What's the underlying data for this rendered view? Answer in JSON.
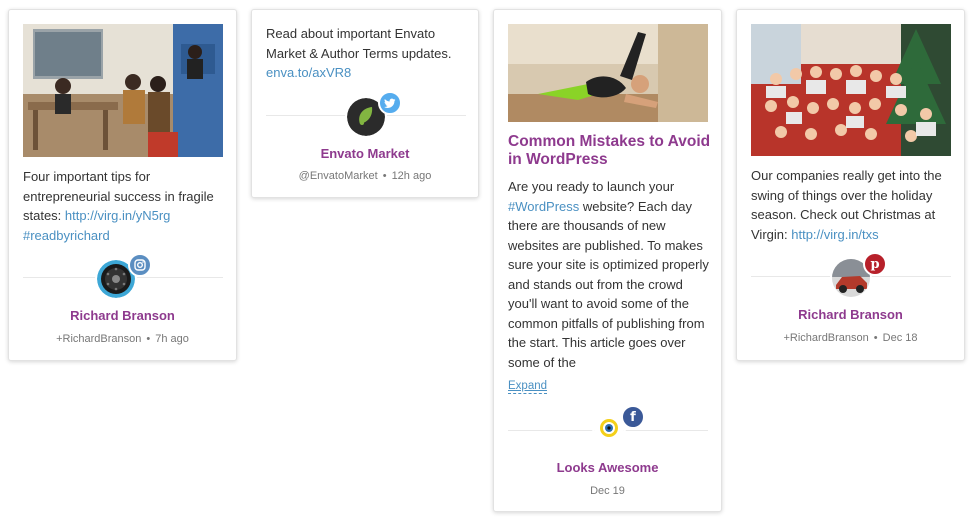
{
  "cards": [
    {
      "text_before_link": "Four important tips for entrepreneurial success in fragile states: ",
      "link": "http://virg.in/yN5rg",
      "hashtag": "#readbyrichard",
      "source_icon": "instagram-icon",
      "author": "Richard Branson",
      "handle": "+RichardBranson",
      "time": "7h ago"
    },
    {
      "text_before_link": "Read about important Envato Market & Author Terms updates.",
      "link": "enva.to/axVR8",
      "source_icon": "twitter-icon",
      "author": "Envato Market",
      "handle": "@EnvatoMarket",
      "time": "12h ago"
    },
    {
      "title": "Common Mistakes to Avoid in WordPress",
      "text_part1": "Are you ready to launch your ",
      "hashtag": "#WordPress",
      "text_part2": " website? Each day there are thousands of new websites are published. To makes sure your site is optimized properly and stands out from the crowd you'll want to avoid some of the common pitfalls of publishing from the start. This article goes over some of the",
      "expand_label": "Expand",
      "source_icon": "facebook-icon",
      "author": "Looks Awesome",
      "time": "Dec 19"
    },
    {
      "text_before_link": "Our companies really get into the swing of things over the holiday season. Check out Christmas at Virgin: ",
      "link": "http://virg.in/txs",
      "source_icon": "pinterest-icon",
      "author": "Richard Branson",
      "handle": "+RichardBranson",
      "time": "Dec 18"
    }
  ],
  "colors": {
    "author": "#8e3a8e",
    "link": "#4a90c2",
    "twitter": "#55acee",
    "facebook": "#3b5998",
    "pinterest": "#b7202a",
    "instagram": "#5b8ec1"
  }
}
